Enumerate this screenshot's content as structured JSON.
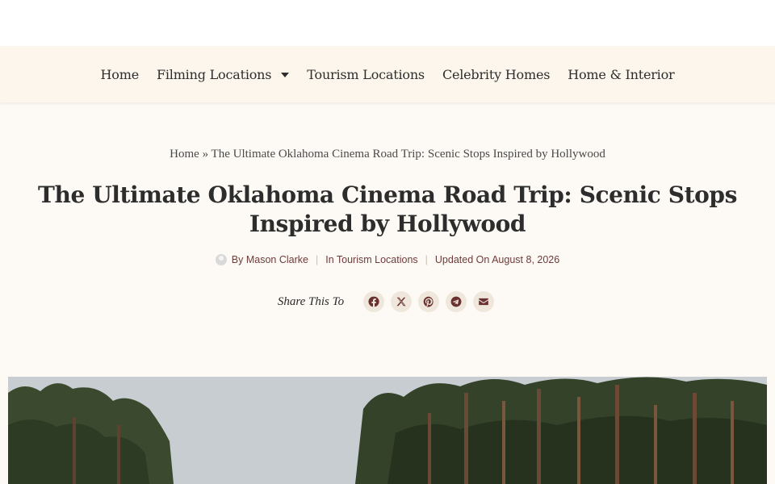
{
  "nav": {
    "items": [
      {
        "label": "Home"
      },
      {
        "label": "Filming Locations"
      },
      {
        "label": "Tourism Locations"
      },
      {
        "label": "Celebrity Homes"
      },
      {
        "label": "Home & Interior"
      }
    ]
  },
  "breadcrumb": {
    "home": "Home",
    "separator": "»",
    "current": "The Ultimate Oklahoma Cinema Road Trip: Scenic Stops Inspired by Hollywood"
  },
  "article": {
    "title": "The Ultimate Oklahoma Cinema Road Trip: Scenic Stops Inspired by Hollywood",
    "author": "By Mason Clarke",
    "category": "In Tourism Locations",
    "updated": "Updated On August 8, 2026",
    "meta_separator": "|"
  },
  "share": {
    "label": "Share This To",
    "icons": [
      "facebook-icon",
      "x-icon",
      "pinterest-icon",
      "telegram-icon",
      "email-icon"
    ]
  },
  "colors": {
    "page_bg": "#fdfaf5",
    "nav_bg": "#fcf6ec",
    "accent": "#6e3a3a",
    "share_bg": "#efe6dc"
  },
  "hero": {
    "icon": "forest-photo"
  }
}
